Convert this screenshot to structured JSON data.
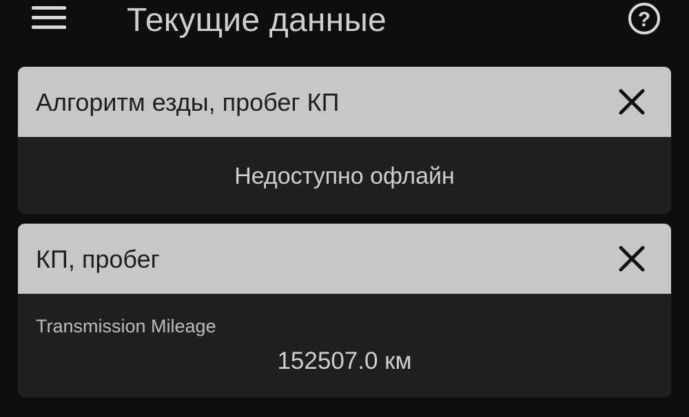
{
  "header": {
    "title": "Текущие данные",
    "menu_icon": "hamburger-menu-icon",
    "help_icon": "help-circle-icon",
    "help_glyph": "?"
  },
  "cards": [
    {
      "title": "Алгоритм езды, пробег КП",
      "close_icon": "close-icon",
      "message": "Недоступно офлайн"
    },
    {
      "title": "КП, пробег",
      "close_icon": "close-icon",
      "parameter": {
        "label": "Transmission Mileage",
        "value": "152507.0 км"
      }
    }
  ],
  "colors": {
    "background": "#0e0e0e",
    "card_header": "#c7c7c7",
    "card_body": "#1f1f1f",
    "text_light": "#cfcfcf",
    "text_dark": "#1e1e1e"
  }
}
